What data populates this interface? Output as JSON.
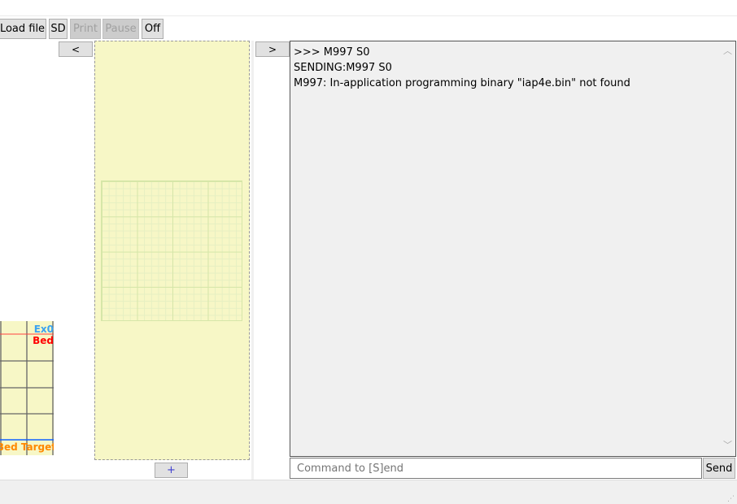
{
  "toolbar": {
    "load_file": "Load file",
    "sd": "SD",
    "print": "Print",
    "pause": "Pause",
    "off": "Off"
  },
  "nav": {
    "prev": "<",
    "next": ">",
    "zoom_in": "+"
  },
  "graph": {
    "labels": {
      "ex0": "Ex0",
      "bed": "Bed",
      "bed_target": "Bed Target"
    },
    "colors": {
      "ex0": "#3ba3f0",
      "bed": "#ff0000",
      "bed_target": "#ff8800"
    }
  },
  "log": {
    "lines": [
      ">>>  M997 S0",
      "SENDING:M997 S0",
      "M997: In-application programming binary \"iap4e.bin\" not found"
    ]
  },
  "command": {
    "placeholder": "Command to [S]end",
    "send": "Send"
  },
  "icons": {
    "scroll_up": "chevron-up-icon",
    "scroll_down": "chevron-down-icon",
    "resize": "resize-grip-icon"
  }
}
